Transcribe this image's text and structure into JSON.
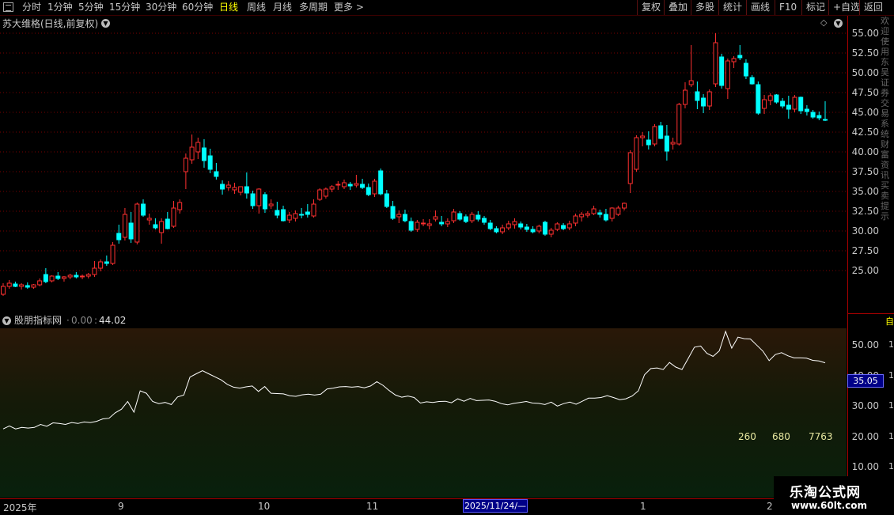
{
  "toolbar": {
    "left": [
      "分时",
      "1分钟",
      "5分钟",
      "15分钟",
      "30分钟",
      "60分钟",
      "日线",
      "周线",
      "月线",
      "多周期",
      "更多 >"
    ],
    "active": "日线",
    "right": [
      "复权",
      "叠加",
      "多股",
      "统计",
      "画线",
      "F10",
      "标记",
      "+自选",
      "返回"
    ]
  },
  "stock": {
    "title": "苏大维格(日线,前复权)"
  },
  "price_axis": {
    "labels": [
      "55.00",
      "52.50",
      "50.00",
      "47.50",
      "45.00",
      "42.50",
      "40.00",
      "37.50",
      "35.00",
      "32.50",
      "30.00",
      "27.50",
      "25.00"
    ]
  },
  "right_strip_text": "欢迎使用东吴证券交易系统财富资讯买卖提示",
  "indicator": {
    "name": "股朋指标网",
    "params": "0.00",
    "value": "44.02",
    "axis_labels": [
      "50.00",
      "40.00",
      "30.00",
      "20.00",
      "10.00"
    ],
    "axis_right": [
      "1",
      "1",
      "1",
      "1",
      "1"
    ],
    "current_badge": "35.05",
    "numbers": [
      "260",
      "680",
      "7763"
    ]
  },
  "date_axis": {
    "labels": [
      "2025年",
      "9",
      "10",
      "11",
      "1",
      "2"
    ],
    "cursor_date": "2025/11/24/—"
  },
  "watermark": {
    "line1": "乐淘公式网",
    "line2": "www.60lt.com"
  },
  "colors": {
    "up": "#ff3030",
    "down": "#00ffff",
    "grid": "#7a0000",
    "indicator_line": "#ffffff"
  },
  "chart_data": {
    "type": "candlestick",
    "y_range": [
      21.5,
      55.5
    ],
    "candles": [
      {
        "o": 22.0,
        "h": 23.4,
        "l": 21.8,
        "c": 23.0
      },
      {
        "o": 23.0,
        "h": 23.8,
        "l": 22.7,
        "c": 23.4
      },
      {
        "o": 23.3,
        "h": 23.6,
        "l": 22.9,
        "c": 23.0
      },
      {
        "o": 23.0,
        "h": 23.4,
        "l": 22.6,
        "c": 23.2
      },
      {
        "o": 23.1,
        "h": 23.5,
        "l": 22.7,
        "c": 22.9
      },
      {
        "o": 22.9,
        "h": 23.3,
        "l": 22.7,
        "c": 23.2
      },
      {
        "o": 23.2,
        "h": 24.0,
        "l": 23.0,
        "c": 23.7
      },
      {
        "o": 24.5,
        "h": 25.3,
        "l": 23.4,
        "c": 23.6
      },
      {
        "o": 23.7,
        "h": 24.4,
        "l": 23.5,
        "c": 24.3
      },
      {
        "o": 24.3,
        "h": 24.8,
        "l": 23.8,
        "c": 24.0
      },
      {
        "o": 24.0,
        "h": 24.3,
        "l": 23.6,
        "c": 24.2
      },
      {
        "o": 24.2,
        "h": 24.6,
        "l": 23.9,
        "c": 24.4
      },
      {
        "o": 24.4,
        "h": 24.8,
        "l": 24.0,
        "c": 24.2
      },
      {
        "o": 24.2,
        "h": 24.5,
        "l": 23.9,
        "c": 24.3
      },
      {
        "o": 24.3,
        "h": 24.7,
        "l": 24.0,
        "c": 24.5
      },
      {
        "o": 24.5,
        "h": 26.2,
        "l": 24.2,
        "c": 25.3
      },
      {
        "o": 25.3,
        "h": 26.4,
        "l": 24.9,
        "c": 26.1
      },
      {
        "o": 26.1,
        "h": 26.9,
        "l": 25.6,
        "c": 25.9
      },
      {
        "o": 25.9,
        "h": 28.6,
        "l": 25.7,
        "c": 28.2
      },
      {
        "o": 29.7,
        "h": 30.8,
        "l": 28.4,
        "c": 28.9
      },
      {
        "o": 29.2,
        "h": 32.9,
        "l": 28.8,
        "c": 32.1
      },
      {
        "o": 31.0,
        "h": 32.4,
        "l": 28.5,
        "c": 29.0
      },
      {
        "o": 28.6,
        "h": 33.6,
        "l": 28.3,
        "c": 33.4
      },
      {
        "o": 33.4,
        "h": 34.0,
        "l": 31.8,
        "c": 32.0
      },
      {
        "o": 31.4,
        "h": 32.2,
        "l": 30.8,
        "c": 31.6
      },
      {
        "o": 30.8,
        "h": 31.6,
        "l": 30.2,
        "c": 30.4
      },
      {
        "o": 29.8,
        "h": 31.6,
        "l": 28.4,
        "c": 31.2
      },
      {
        "o": 31.5,
        "h": 32.4,
        "l": 30.2,
        "c": 30.3
      },
      {
        "o": 30.6,
        "h": 33.8,
        "l": 30.4,
        "c": 32.9
      },
      {
        "o": 32.7,
        "h": 34.0,
        "l": 32.2,
        "c": 33.6
      },
      {
        "o": 37.5,
        "h": 39.8,
        "l": 35.3,
        "c": 39.2
      },
      {
        "o": 39.0,
        "h": 42.2,
        "l": 38.5,
        "c": 40.6
      },
      {
        "o": 40.0,
        "h": 41.8,
        "l": 39.1,
        "c": 41.2
      },
      {
        "o": 40.5,
        "h": 41.6,
        "l": 38.0,
        "c": 38.9
      },
      {
        "o": 39.5,
        "h": 40.4,
        "l": 37.3,
        "c": 37.8
      },
      {
        "o": 37.5,
        "h": 38.6,
        "l": 36.5,
        "c": 36.9
      },
      {
        "o": 35.9,
        "h": 36.4,
        "l": 34.6,
        "c": 35.3
      },
      {
        "o": 35.5,
        "h": 36.3,
        "l": 35.1,
        "c": 35.8
      },
      {
        "o": 35.2,
        "h": 36.1,
        "l": 34.7,
        "c": 35.5
      },
      {
        "o": 34.9,
        "h": 35.6,
        "l": 34.5,
        "c": 35.6
      },
      {
        "o": 35.6,
        "h": 37.4,
        "l": 34.1,
        "c": 34.8
      },
      {
        "o": 34.7,
        "h": 35.1,
        "l": 32.8,
        "c": 33.2
      },
      {
        "o": 33.2,
        "h": 35.4,
        "l": 32.2,
        "c": 35.3
      },
      {
        "o": 34.6,
        "h": 34.9,
        "l": 32.3,
        "c": 32.8
      },
      {
        "o": 33.2,
        "h": 34.0,
        "l": 32.8,
        "c": 33.4
      },
      {
        "o": 32.6,
        "h": 33.7,
        "l": 31.6,
        "c": 32.0
      },
      {
        "o": 32.7,
        "h": 33.2,
        "l": 31.2,
        "c": 31.3
      },
      {
        "o": 31.4,
        "h": 32.4,
        "l": 31.0,
        "c": 32.0
      },
      {
        "o": 31.6,
        "h": 32.6,
        "l": 31.2,
        "c": 32.2
      },
      {
        "o": 32.1,
        "h": 32.9,
        "l": 31.6,
        "c": 32.0
      },
      {
        "o": 32.4,
        "h": 33.4,
        "l": 31.7,
        "c": 32.1
      },
      {
        "o": 31.9,
        "h": 34.0,
        "l": 31.7,
        "c": 33.4
      },
      {
        "o": 34.0,
        "h": 35.4,
        "l": 33.8,
        "c": 35.2
      },
      {
        "o": 34.4,
        "h": 35.5,
        "l": 34.1,
        "c": 35.3
      },
      {
        "o": 35.3,
        "h": 35.8,
        "l": 34.9,
        "c": 35.6
      },
      {
        "o": 35.8,
        "h": 36.3,
        "l": 35.2,
        "c": 35.9
      },
      {
        "o": 35.6,
        "h": 36.5,
        "l": 35.3,
        "c": 36.1
      },
      {
        "o": 35.9,
        "h": 36.2,
        "l": 35.2,
        "c": 35.7
      },
      {
        "o": 35.8,
        "h": 37.1,
        "l": 35.5,
        "c": 36.0
      },
      {
        "o": 35.9,
        "h": 36.6,
        "l": 35.3,
        "c": 35.5
      },
      {
        "o": 35.5,
        "h": 36.0,
        "l": 34.4,
        "c": 34.6
      },
      {
        "o": 34.7,
        "h": 36.6,
        "l": 34.3,
        "c": 36.3
      },
      {
        "o": 37.6,
        "h": 37.9,
        "l": 34.5,
        "c": 34.7
      },
      {
        "o": 34.7,
        "h": 35.2,
        "l": 32.9,
        "c": 33.1
      },
      {
        "o": 33.1,
        "h": 33.8,
        "l": 31.4,
        "c": 31.6
      },
      {
        "o": 31.8,
        "h": 32.6,
        "l": 31.0,
        "c": 32.1
      },
      {
        "o": 32.1,
        "h": 32.7,
        "l": 31.1,
        "c": 31.3
      },
      {
        "o": 31.2,
        "h": 31.7,
        "l": 29.9,
        "c": 30.1
      },
      {
        "o": 30.2,
        "h": 31.4,
        "l": 29.9,
        "c": 31.1
      },
      {
        "o": 31.0,
        "h": 31.5,
        "l": 30.6,
        "c": 31.0
      },
      {
        "o": 30.7,
        "h": 31.5,
        "l": 30.2,
        "c": 30.9
      },
      {
        "o": 31.5,
        "h": 32.6,
        "l": 31.2,
        "c": 31.8
      },
      {
        "o": 31.1,
        "h": 31.9,
        "l": 30.6,
        "c": 30.9
      },
      {
        "o": 30.9,
        "h": 31.6,
        "l": 30.5,
        "c": 31.2
      },
      {
        "o": 31.3,
        "h": 32.8,
        "l": 31.0,
        "c": 32.4
      },
      {
        "o": 32.2,
        "h": 32.5,
        "l": 31.3,
        "c": 31.5
      },
      {
        "o": 31.8,
        "h": 32.1,
        "l": 31.0,
        "c": 31.2
      },
      {
        "o": 31.3,
        "h": 32.4,
        "l": 31.0,
        "c": 32.1
      },
      {
        "o": 32.0,
        "h": 32.5,
        "l": 31.2,
        "c": 31.5
      },
      {
        "o": 31.6,
        "h": 31.9,
        "l": 30.8,
        "c": 31.1
      },
      {
        "o": 31.0,
        "h": 31.4,
        "l": 30.1,
        "c": 30.3
      },
      {
        "o": 30.3,
        "h": 30.6,
        "l": 29.7,
        "c": 29.9
      },
      {
        "o": 29.9,
        "h": 30.8,
        "l": 29.6,
        "c": 30.4
      },
      {
        "o": 30.4,
        "h": 31.3,
        "l": 30.1,
        "c": 30.9
      },
      {
        "o": 30.8,
        "h": 31.6,
        "l": 30.3,
        "c": 31.2
      },
      {
        "o": 30.9,
        "h": 31.2,
        "l": 30.2,
        "c": 30.5
      },
      {
        "o": 30.5,
        "h": 30.9,
        "l": 29.9,
        "c": 30.2
      },
      {
        "o": 30.2,
        "h": 30.6,
        "l": 29.7,
        "c": 29.9
      },
      {
        "o": 30.0,
        "h": 30.8,
        "l": 29.7,
        "c": 30.6
      },
      {
        "o": 31.1,
        "h": 31.3,
        "l": 29.4,
        "c": 29.6
      },
      {
        "o": 29.6,
        "h": 30.4,
        "l": 29.2,
        "c": 30.1
      },
      {
        "o": 30.2,
        "h": 31.1,
        "l": 30.0,
        "c": 30.9
      },
      {
        "o": 30.7,
        "h": 31.0,
        "l": 30.1,
        "c": 30.3
      },
      {
        "o": 30.4,
        "h": 31.3,
        "l": 30.1,
        "c": 30.9
      },
      {
        "o": 31.0,
        "h": 32.2,
        "l": 30.6,
        "c": 31.9
      },
      {
        "o": 31.8,
        "h": 32.4,
        "l": 31.2,
        "c": 32.1
      },
      {
        "o": 32.0,
        "h": 32.5,
        "l": 31.7,
        "c": 32.2
      },
      {
        "o": 32.2,
        "h": 33.2,
        "l": 32.0,
        "c": 32.8
      },
      {
        "o": 32.3,
        "h": 32.7,
        "l": 31.7,
        "c": 32.1
      },
      {
        "o": 32.1,
        "h": 32.8,
        "l": 31.2,
        "c": 31.4
      },
      {
        "o": 31.6,
        "h": 33.0,
        "l": 31.2,
        "c": 32.9
      },
      {
        "o": 32.1,
        "h": 33.2,
        "l": 31.9,
        "c": 32.9
      },
      {
        "o": 32.9,
        "h": 33.6,
        "l": 32.6,
        "c": 33.5
      },
      {
        "o": 36.0,
        "h": 40.2,
        "l": 34.8,
        "c": 39.9
      },
      {
        "o": 37.8,
        "h": 42.1,
        "l": 37.5,
        "c": 41.8
      },
      {
        "o": 41.8,
        "h": 42.5,
        "l": 40.7,
        "c": 42.0
      },
      {
        "o": 41.5,
        "h": 42.6,
        "l": 40.3,
        "c": 40.9
      },
      {
        "o": 41.0,
        "h": 43.5,
        "l": 40.7,
        "c": 43.2
      },
      {
        "o": 43.3,
        "h": 43.8,
        "l": 41.6,
        "c": 41.7
      },
      {
        "o": 42.0,
        "h": 43.4,
        "l": 38.9,
        "c": 40.1
      },
      {
        "o": 41.0,
        "h": 41.8,
        "l": 40.3,
        "c": 41.2
      },
      {
        "o": 41.0,
        "h": 46.2,
        "l": 40.8,
        "c": 46.0
      },
      {
        "o": 46.0,
        "h": 48.8,
        "l": 45.5,
        "c": 47.8
      },
      {
        "o": 48.5,
        "h": 53.5,
        "l": 48.2,
        "c": 49.0
      },
      {
        "o": 47.6,
        "h": 48.9,
        "l": 45.4,
        "c": 46.5
      },
      {
        "o": 46.8,
        "h": 47.3,
        "l": 44.9,
        "c": 45.8
      },
      {
        "o": 45.8,
        "h": 47.9,
        "l": 45.3,
        "c": 47.6
      },
      {
        "o": 48.6,
        "h": 55.0,
        "l": 48.2,
        "c": 53.8
      },
      {
        "o": 52.0,
        "h": 52.4,
        "l": 48.0,
        "c": 48.4
      },
      {
        "o": 48.0,
        "h": 51.8,
        "l": 46.7,
        "c": 51.5
      },
      {
        "o": 51.4,
        "h": 52.1,
        "l": 50.6,
        "c": 51.8
      },
      {
        "o": 52.2,
        "h": 53.5,
        "l": 51.6,
        "c": 51.9
      },
      {
        "o": 51.2,
        "h": 51.7,
        "l": 49.2,
        "c": 49.6
      },
      {
        "o": 49.4,
        "h": 49.7,
        "l": 48.5,
        "c": 48.6
      },
      {
        "o": 48.5,
        "h": 48.9,
        "l": 44.7,
        "c": 44.9
      },
      {
        "o": 45.5,
        "h": 47.2,
        "l": 44.8,
        "c": 46.6
      },
      {
        "o": 46.5,
        "h": 47.4,
        "l": 45.9,
        "c": 47.1
      },
      {
        "o": 47.2,
        "h": 47.3,
        "l": 46.1,
        "c": 46.3
      },
      {
        "o": 46.4,
        "h": 46.8,
        "l": 45.5,
        "c": 45.8
      },
      {
        "o": 45.9,
        "h": 47.1,
        "l": 44.2,
        "c": 45.4
      },
      {
        "o": 45.4,
        "h": 47.2,
        "l": 45.0,
        "c": 46.9
      },
      {
        "o": 46.9,
        "h": 47.0,
        "l": 44.8,
        "c": 45.2
      },
      {
        "o": 45.4,
        "h": 45.9,
        "l": 44.6,
        "c": 45.1
      },
      {
        "o": 45.0,
        "h": 45.3,
        "l": 44.2,
        "c": 44.4
      },
      {
        "o": 44.6,
        "h": 45.1,
        "l": 44.0,
        "c": 44.3
      },
      {
        "o": 44.1,
        "h": 46.4,
        "l": 43.9,
        "c": 44.0
      }
    ],
    "indicator": {
      "y_range": [
        0,
        55.5
      ],
      "values": [
        22.5,
        23.5,
        22.5,
        23.0,
        22.8,
        23.0,
        24.0,
        23.4,
        24.5,
        24.3,
        24.0,
        24.6,
        24.3,
        24.8,
        24.6,
        25.0,
        25.8,
        26.0,
        27.8,
        29.0,
        31.5,
        28.0,
        35.0,
        34.2,
        31.5,
        30.8,
        31.2,
        30.5,
        33.0,
        33.6,
        39.5,
        40.6,
        41.6,
        40.6,
        39.6,
        38.6,
        37.1,
        36.2,
        35.9,
        36.3,
        36.6,
        34.8,
        36.4,
        34.2,
        34.1,
        34.0,
        33.4,
        33.2,
        33.7,
        33.9,
        33.6,
        33.9,
        35.6,
        35.9,
        36.3,
        36.4,
        36.2,
        36.4,
        36.0,
        36.6,
        38.0,
        36.8,
        35.1,
        33.6,
        32.9,
        33.3,
        32.8,
        31.0,
        31.4,
        31.2,
        31.5,
        31.6,
        31.1,
        32.4,
        31.6,
        32.5,
        31.8,
        31.9,
        32.0,
        31.6,
        30.8,
        30.4,
        30.9,
        31.2,
        31.5,
        31.0,
        30.9,
        30.5,
        31.3,
        30.0,
        30.8,
        31.3,
        30.6,
        31.6,
        32.6,
        32.6,
        32.8,
        33.4,
        32.8,
        32.1,
        32.4,
        33.3,
        35.0,
        40.3,
        42.3,
        42.5,
        42.0,
        44.3,
        42.8,
        42.0,
        45.6,
        49.3,
        49.7,
        47.3,
        46.3,
        48.1,
        54.5,
        49.0,
        52.6,
        52.1,
        52.0,
        50.0,
        48.0,
        44.9,
        46.9,
        47.5,
        46.5,
        45.8,
        45.8,
        45.7,
        45.0,
        44.8,
        44.2
      ]
    }
  }
}
